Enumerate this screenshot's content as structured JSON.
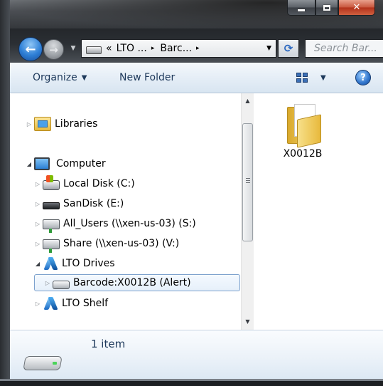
{
  "window": {
    "caption_buttons": [
      "minimize",
      "maximize",
      "close"
    ]
  },
  "nav": {
    "back_icon": "back-arrow-icon",
    "forward_icon": "forward-arrow-icon"
  },
  "address": {
    "overflow": "«",
    "segments": [
      "LTO ...",
      "Barc..."
    ],
    "separator": "▸"
  },
  "search": {
    "placeholder": "Search Bar..."
  },
  "toolbar": {
    "organize_label": "Organize",
    "new_folder_label": "New Folder",
    "help_label": "?"
  },
  "tree": {
    "libraries": "Libraries",
    "computer": "Computer",
    "local_disk": "Local Disk (C:)",
    "sandisk": "SanDisk (E:)",
    "all_users": "All_Users (\\\\xen-us-03) (S:)",
    "share": "Share (\\\\xen-us-03) (V:)",
    "lto_drives": "LTO Drives",
    "barcode": "Barcode:X0012B (Alert)",
    "lto_shelf": "LTO Shelf"
  },
  "content": {
    "items": [
      {
        "label": "X0012B",
        "icon": "folder-icon"
      }
    ]
  },
  "details": {
    "count": "1 item"
  },
  "colors": {
    "toolbar_text": "#1e395b",
    "selection_border": "#7da2ce",
    "close_button": "#c8563c"
  }
}
